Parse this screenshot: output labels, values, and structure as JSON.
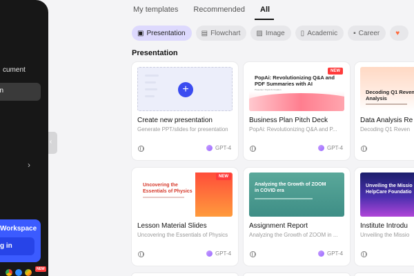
{
  "sidebar": {
    "doc_item_label": "cument",
    "active_item_label": "on",
    "chevron_icon": "chevron-right-icon",
    "workspace_title": "Workspace",
    "login_label": "g in",
    "new_badge": "NEW"
  },
  "tabs": [
    {
      "label": "My templates",
      "active": false
    },
    {
      "label": "Recommended",
      "active": false
    },
    {
      "label": "All",
      "active": true
    }
  ],
  "filters": [
    {
      "label": "Presentation",
      "icon": "presentation-icon",
      "active": true
    },
    {
      "label": "Flowchart",
      "icon": "flowchart-icon",
      "active": false
    },
    {
      "label": "Image",
      "icon": "image-icon",
      "active": false
    },
    {
      "label": "Academic",
      "icon": "book-icon",
      "active": false
    },
    {
      "label": "Career",
      "icon": "briefcase-icon",
      "active": false
    }
  ],
  "section_title": "Presentation",
  "cards": [
    {
      "title": "Create new presentation",
      "desc": "Generate PPT/slides for presentation",
      "model": "GPT-4",
      "new": false
    },
    {
      "title": "Business Plan Pitch Deck",
      "desc": "PopAi: Revolutionizing Q&A and P...",
      "model": "GPT-4",
      "new": true,
      "thumb_title": "PopAi: Revolutionizing Q&A and PDF Summaries with AI",
      "thumb_sub": "Presenter: PopAI AI Creation"
    },
    {
      "title": "Data Analysis Re",
      "desc": "Decoding Q1 Reven",
      "model": "GPT-4",
      "new": true,
      "thumb_title": "Decoding Q1 Reven\nAnalysis"
    },
    {
      "title": "Lesson Material Slides",
      "desc": "Uncovering the Essentials of Physics",
      "model": "GPT-4",
      "new": true,
      "thumb_title": "Uncovering the\nEssentials of Physics"
    },
    {
      "title": "Assignment Report",
      "desc": "Analyzing the Growth of ZOOM in ...",
      "model": "GPT-4",
      "new": false,
      "thumb_title": "Analyzing the Growth of ZOOM\nin COVID era"
    },
    {
      "title": "Institute Introdu",
      "desc": "Unveiling the Missio",
      "model": "GPT-4",
      "new": false,
      "thumb_title": "Unveiling the Missio\nHelpCare Foundatio"
    }
  ],
  "colors": {
    "accent": "#3b4cf0",
    "active_chip": "#ddd9fd",
    "new_badge": "#ff3b3b",
    "sidebar": "#171717"
  }
}
